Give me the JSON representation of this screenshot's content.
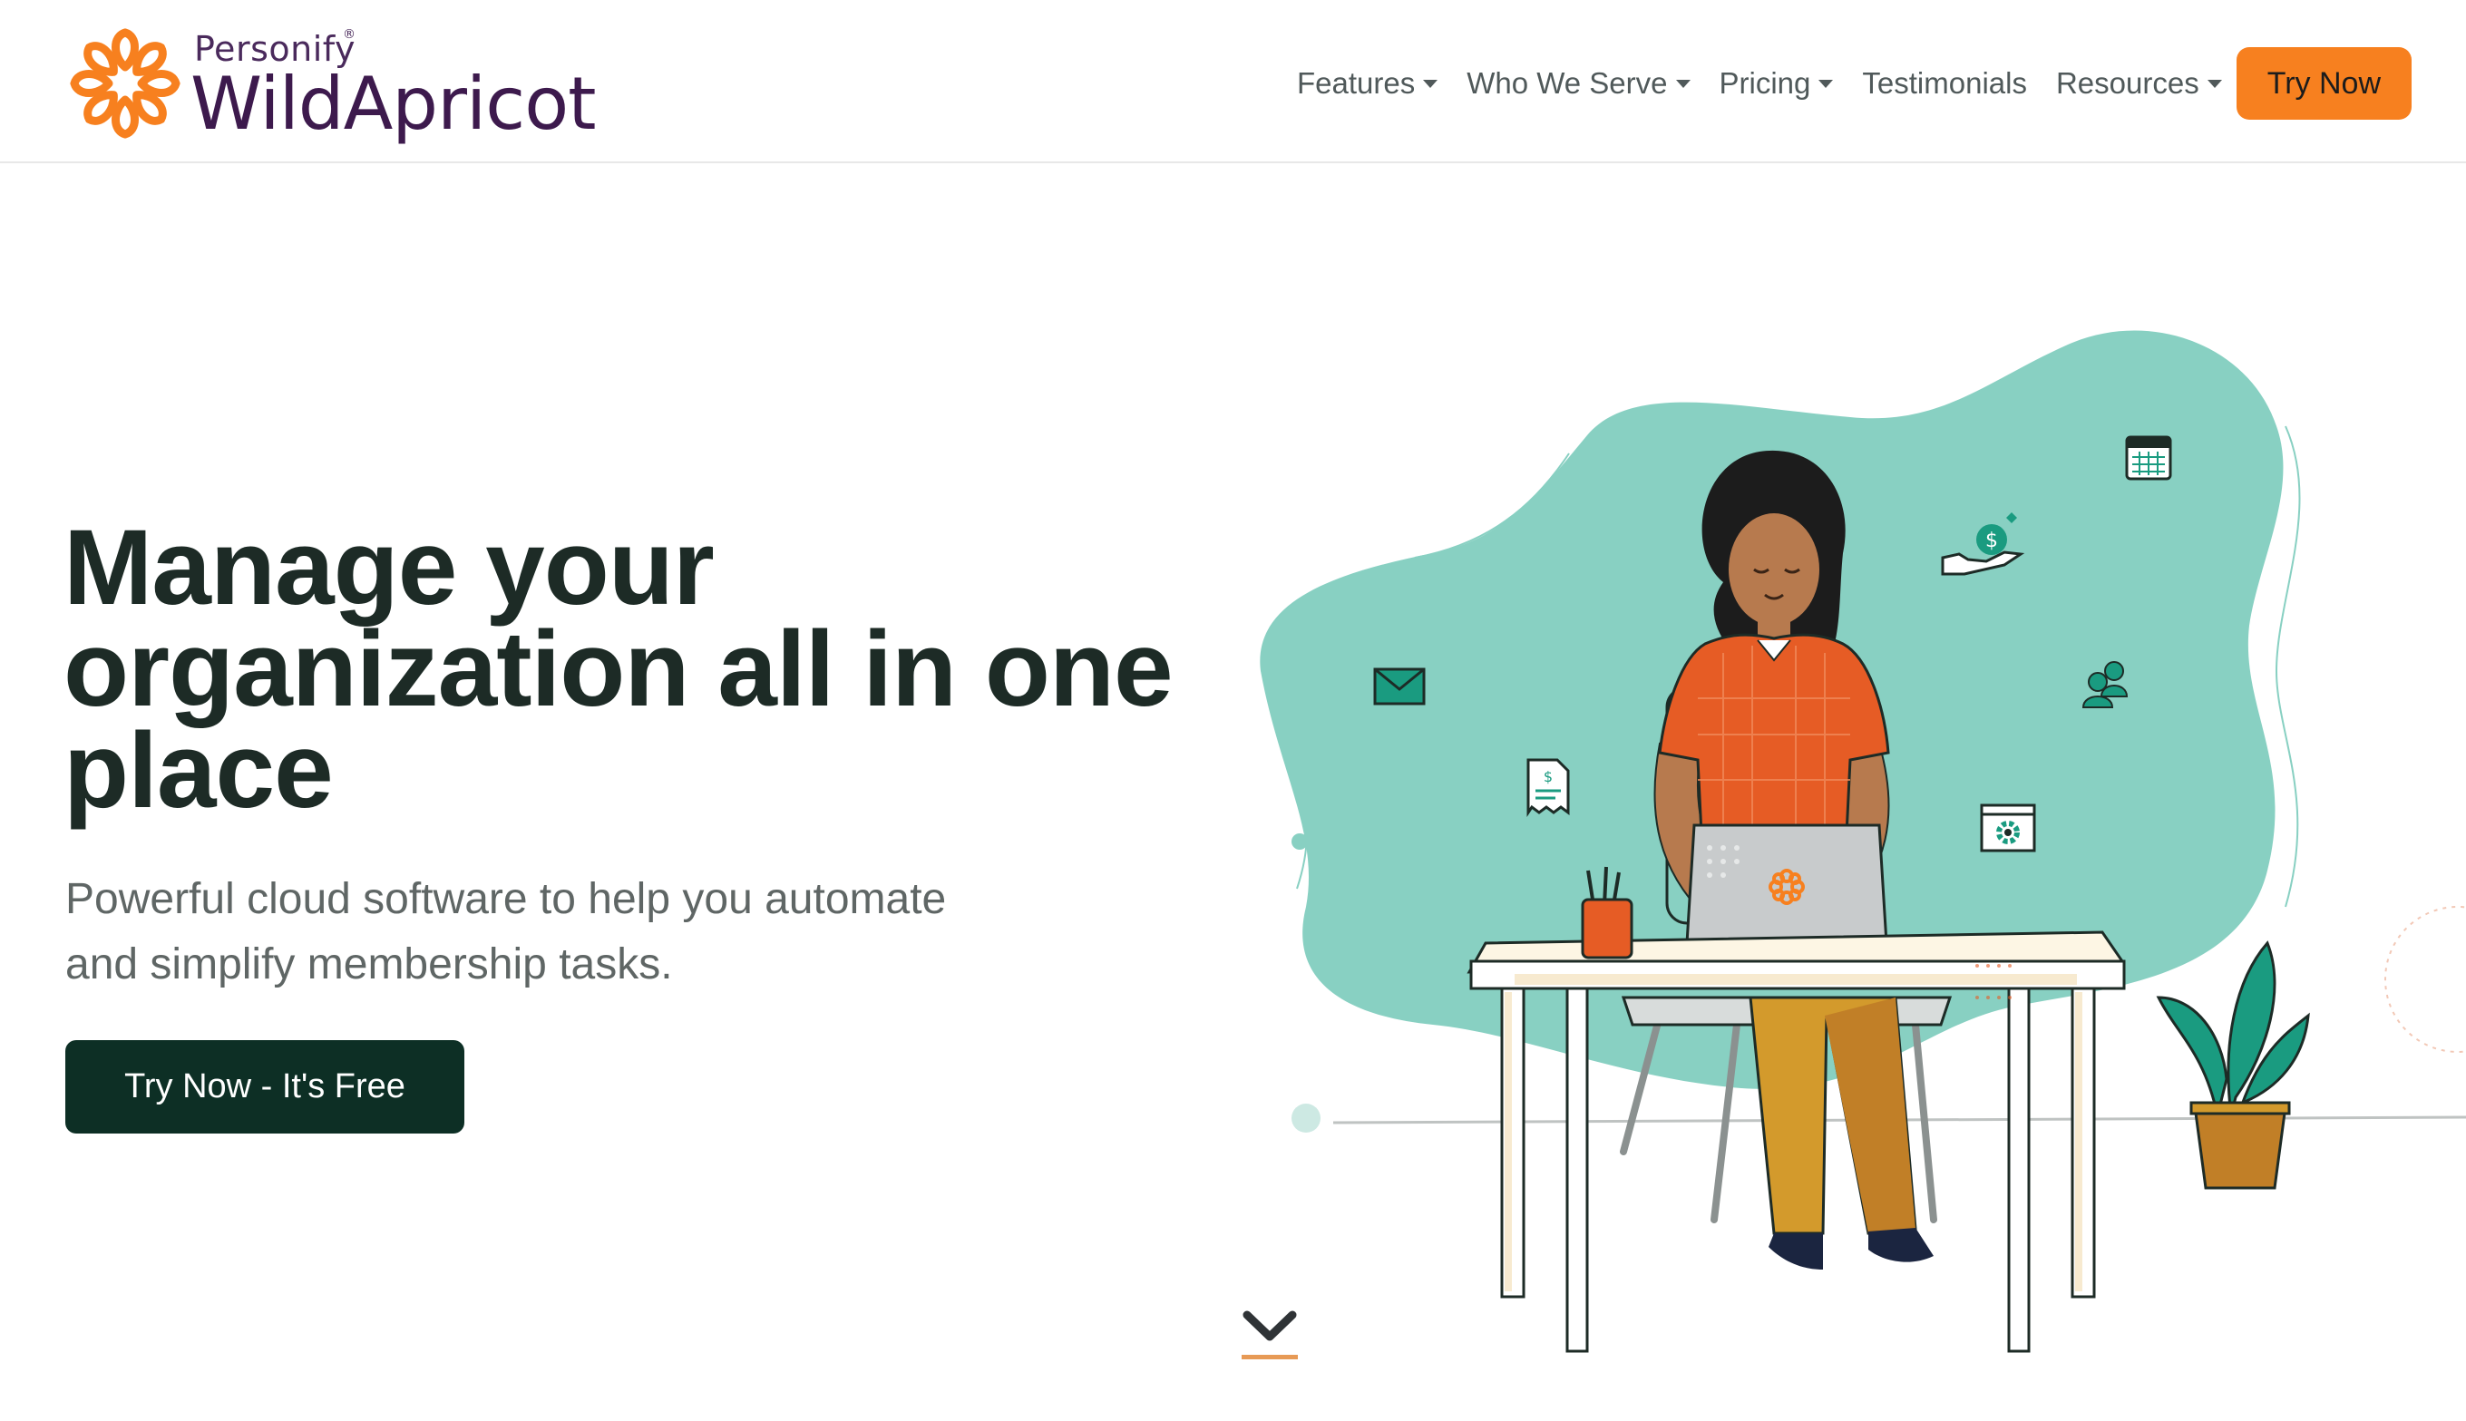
{
  "brand": {
    "company": "Personify",
    "product": "WildApricot",
    "reg_mark": "®"
  },
  "nav": {
    "items": [
      {
        "label": "Features",
        "dropdown": true
      },
      {
        "label": "Who We Serve",
        "dropdown": true
      },
      {
        "label": "Pricing",
        "dropdown": true
      },
      {
        "label": "Testimonials",
        "dropdown": false
      },
      {
        "label": "Resources",
        "dropdown": true
      }
    ],
    "cta_label": "Try Now"
  },
  "hero": {
    "title_line1": "Manage your",
    "title_line2": "organization all in one",
    "title_line3": "place",
    "subtitle_line1": "Powerful cloud software to help you automate",
    "subtitle_line2": "and simplify membership tasks.",
    "cta_label": "Try Now - It's Free"
  },
  "illustration": {
    "icons": [
      "calendar-icon",
      "money-hand-icon",
      "email-icon",
      "people-icon",
      "invoice-icon",
      "settings-window-icon",
      "logo-icon"
    ]
  },
  "colors": {
    "accent_orange": "#f7801f",
    "brand_purple": "#3d1a4d",
    "dark_green": "#0d2f25",
    "teal_blob": "#88d0c2",
    "shirt_orange": "#e65c25",
    "pants_mustard": "#d39a2c",
    "icon_teal": "#1a9b80"
  }
}
